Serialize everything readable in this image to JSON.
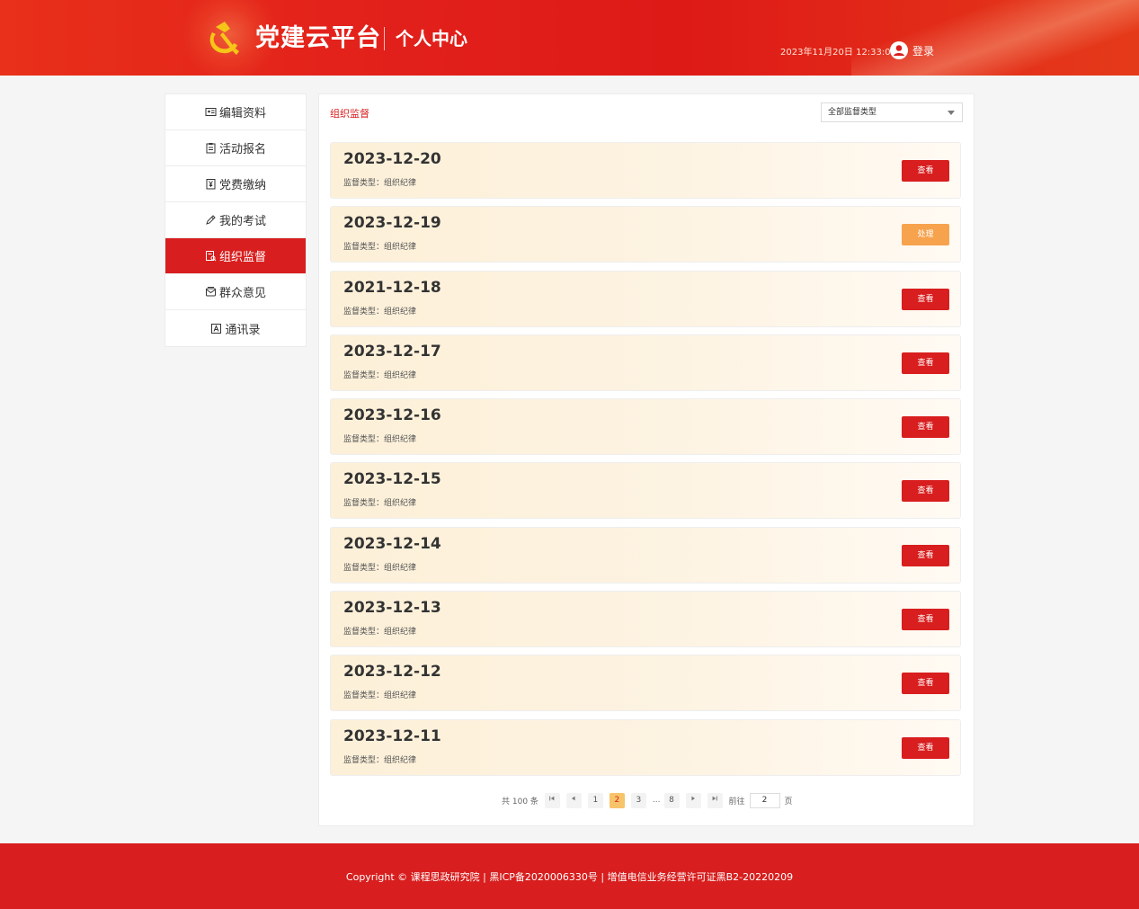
{
  "header": {
    "brand_title": "党建云平台",
    "brand_sub": "个人中心",
    "datetime": "2023年11月20日 12:33:00",
    "login_label": "登录",
    "accent": "#d81e1e",
    "gold": "#f5c518"
  },
  "sidebar": {
    "items": [
      {
        "label": "编辑资料",
        "icon": "id-card-icon"
      },
      {
        "label": "活动报名",
        "icon": "clipboard-icon"
      },
      {
        "label": "党费缴纳",
        "icon": "yuan-document-icon"
      },
      {
        "label": "我的考试",
        "icon": "pen-icon"
      },
      {
        "label": "组织监督",
        "icon": "supervise-icon",
        "active": true
      },
      {
        "label": "群众意见",
        "icon": "envelope-icon"
      },
      {
        "label": "通讯录",
        "icon": "contacts-icon"
      }
    ]
  },
  "main": {
    "title": "组织监督",
    "filter": {
      "selected": "全部监督类型"
    },
    "records": [
      {
        "date": "2023-12-20",
        "meta": "监督类型：组织纪律",
        "action": "查看",
        "kind": "view"
      },
      {
        "date": "2023-12-19",
        "meta": "监督类型：组织纪律",
        "action": "处理",
        "kind": "handle"
      },
      {
        "date": "2021-12-18",
        "meta": "监督类型：组织纪律",
        "action": "查看",
        "kind": "view"
      },
      {
        "date": "2023-12-17",
        "meta": "监督类型：组织纪律",
        "action": "查看",
        "kind": "view"
      },
      {
        "date": "2023-12-16",
        "meta": "监督类型：组织纪律",
        "action": "查看",
        "kind": "view"
      },
      {
        "date": "2023-12-15",
        "meta": "监督类型：组织纪律",
        "action": "查看",
        "kind": "view"
      },
      {
        "date": "2023-12-14",
        "meta": "监督类型：组织纪律",
        "action": "查看",
        "kind": "view"
      },
      {
        "date": "2023-12-13",
        "meta": "监督类型：组织纪律",
        "action": "查看",
        "kind": "view"
      },
      {
        "date": "2023-12-12",
        "meta": "监督类型：组织纪律",
        "action": "查看",
        "kind": "view"
      },
      {
        "date": "2023-12-11",
        "meta": "监督类型：组织纪律",
        "action": "查看",
        "kind": "view"
      }
    ]
  },
  "pagination": {
    "total_text": "共 100 条",
    "pages": [
      "1",
      "2",
      "3",
      "...",
      "8"
    ],
    "current": "2",
    "goto_label": "前往",
    "goto_value": "2",
    "page_unit": "页"
  },
  "footer": {
    "text": "Copyright © 课程思政研究院 | 黑ICP备2020006330号 | 增值电信业务经营许可证黑B2-20220209"
  }
}
